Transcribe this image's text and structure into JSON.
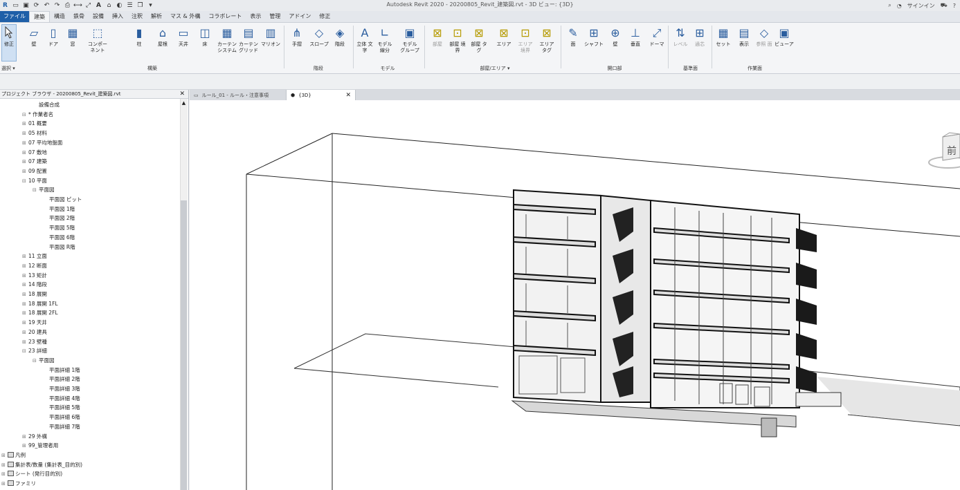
{
  "window": {
    "title": "Autodesk Revit 2020 - 20200805_Revit_建築図.rvt - 3D ビュー: {3D}",
    "signin": "サインイン"
  },
  "ribbon_tabs": [
    "ファイル",
    "建築",
    "構造",
    "鉄骨",
    "設備",
    "挿入",
    "注釈",
    "解析",
    "マス & 外構",
    "コラボレート",
    "表示",
    "管理",
    "アドイン",
    "修正"
  ],
  "ribbon": {
    "modify": "修正",
    "select": "選択 ▾",
    "buttons": {
      "wall": "壁",
      "door": "ドア",
      "window": "窓",
      "component": "コンポーネント",
      "column": "柱",
      "roof": "屋根",
      "ceiling": "天井",
      "floor": "床",
      "curtain_system": "カーテン システム",
      "curtain_grid": "カーテン グリッド",
      "mullion": "マリオン",
      "railing": "手摺",
      "ramp": "スロープ",
      "stair": "階段",
      "model_text": "立体 文字",
      "model_line": "モデル 線分",
      "model_group": "モデル グループ",
      "room": "部屋",
      "room_separator": "部屋 境界",
      "room_tag": "部屋 タグ",
      "area": "エリア",
      "area_boundary": "エリア 境界",
      "area_tag": "エリア タグ",
      "by_face": "面",
      "shaft": "シャフト",
      "wall_opening": "壁",
      "vertical": "垂直",
      "dormer": "ドーマ",
      "level": "レベル",
      "grid": "通芯",
      "set": "セット",
      "show": "表示",
      "ref_plane": "参照 面",
      "viewer": "ビューア"
    },
    "panels": {
      "build": "構築",
      "circulation": "階段",
      "model": "モデル",
      "room_area": "部屋/エリア ▾",
      "opening": "開口部",
      "datum": "基準面",
      "work_plane": "作業面"
    }
  },
  "browser": {
    "title": "プロジェクト ブラウザ - 20200805_Revit_建築図.rvt",
    "items": [
      {
        "label": "設備合成",
        "indent": 3,
        "toggle": ""
      },
      {
        "label": "* 作業者名",
        "indent": 2,
        "toggle": "⊟"
      },
      {
        "label": "01 概要",
        "indent": 2,
        "toggle": "⊞"
      },
      {
        "label": "05 材料",
        "indent": 2,
        "toggle": "⊞"
      },
      {
        "label": "07 平均地盤面",
        "indent": 2,
        "toggle": "⊞"
      },
      {
        "label": "07 敷地",
        "indent": 2,
        "toggle": "⊞"
      },
      {
        "label": "07 建築",
        "indent": 2,
        "toggle": "⊞"
      },
      {
        "label": "09 配置",
        "indent": 2,
        "toggle": "⊞"
      },
      {
        "label": "10 平面",
        "indent": 2,
        "toggle": "⊟"
      },
      {
        "label": "平面図",
        "indent": 3,
        "toggle": "⊟"
      },
      {
        "label": "平面図 ピット",
        "indent": 4,
        "toggle": ""
      },
      {
        "label": "平面図 1階",
        "indent": 4,
        "toggle": ""
      },
      {
        "label": "平面図 2階",
        "indent": 4,
        "toggle": ""
      },
      {
        "label": "平面図 5階",
        "indent": 4,
        "toggle": ""
      },
      {
        "label": "平面図 6階",
        "indent": 4,
        "toggle": ""
      },
      {
        "label": "平面図 R階",
        "indent": 4,
        "toggle": ""
      },
      {
        "label": "11 立面",
        "indent": 2,
        "toggle": "⊞"
      },
      {
        "label": "12 断面",
        "indent": 2,
        "toggle": "⊞"
      },
      {
        "label": "13 矩計",
        "indent": 2,
        "toggle": "⊞"
      },
      {
        "label": "14 階段",
        "indent": 2,
        "toggle": "⊞"
      },
      {
        "label": "18 展開",
        "indent": 2,
        "toggle": "⊞"
      },
      {
        "label": "18 展開 1FL",
        "indent": 2,
        "toggle": "⊞"
      },
      {
        "label": "18 展開 2FL",
        "indent": 2,
        "toggle": "⊞"
      },
      {
        "label": "19 天井",
        "indent": 2,
        "toggle": "⊞"
      },
      {
        "label": "20 建具",
        "indent": 2,
        "toggle": "⊞"
      },
      {
        "label": "23 壁種",
        "indent": 2,
        "toggle": "⊞"
      },
      {
        "label": "23 詳細",
        "indent": 2,
        "toggle": "⊟"
      },
      {
        "label": "平面図",
        "indent": 3,
        "toggle": "⊟"
      },
      {
        "label": "平面詳細 1階",
        "indent": 4,
        "toggle": ""
      },
      {
        "label": "平面詳細 2階",
        "indent": 4,
        "toggle": ""
      },
      {
        "label": "平面詳細 3階",
        "indent": 4,
        "toggle": ""
      },
      {
        "label": "平面詳細 4階",
        "indent": 4,
        "toggle": ""
      },
      {
        "label": "平面詳細 5階",
        "indent": 4,
        "toggle": ""
      },
      {
        "label": "平面詳細 6階",
        "indent": 4,
        "toggle": ""
      },
      {
        "label": "平面詳細 7階",
        "indent": 4,
        "toggle": ""
      },
      {
        "label": "29 外構",
        "indent": 2,
        "toggle": "⊞"
      },
      {
        "label": "99_管理者用",
        "indent": 2,
        "toggle": "⊞"
      },
      {
        "label": "凡例",
        "indent": 0,
        "toggle": "⊞",
        "icon": true
      },
      {
        "label": "集計表/数量 (集計表_目的別)",
        "indent": 0,
        "toggle": "⊞",
        "icon": true
      },
      {
        "label": "シート (発行目的別)",
        "indent": 0,
        "toggle": "⊞",
        "icon": true
      },
      {
        "label": "ファミリ",
        "indent": 0,
        "toggle": "⊞",
        "icon": true
      }
    ]
  },
  "view_tabs": [
    {
      "label": "ルール_01 - ルール・注意事項",
      "active": false
    },
    {
      "label": "{3D}",
      "active": true
    }
  ],
  "viewcube": {
    "face": "前"
  }
}
